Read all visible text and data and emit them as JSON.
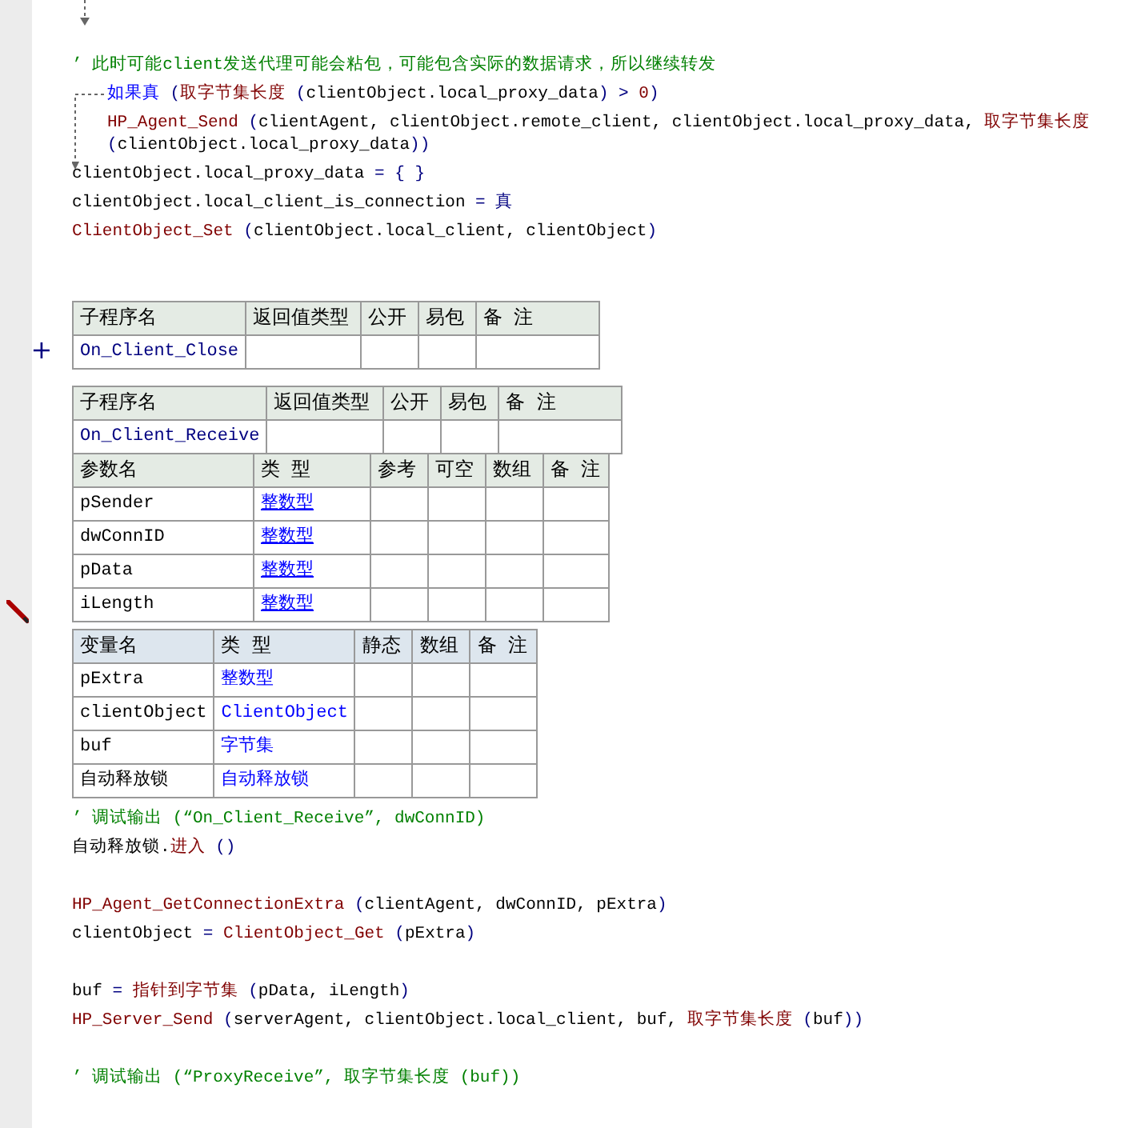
{
  "top_code": [
    {
      "kind": "line",
      "tokens": [
        {
          "kind": "comment",
          "text": "’ 此时可能client发送代理可能会粘包，可能包含实际的数据请求，所以继续转发"
        }
      ]
    },
    {
      "kind": "if",
      "tokens": [
        {
          "kind": "keyword",
          "text": "如果真"
        },
        {
          "kind": "punct",
          "text": " ("
        },
        {
          "kind": "func",
          "text": "取字节集长度"
        },
        {
          "kind": "punct",
          "text": " ("
        },
        {
          "kind": "text",
          "text": "clientObject.local_proxy_data"
        },
        {
          "kind": "punct",
          "text": ") > "
        },
        {
          "kind": "func",
          "text": "0"
        },
        {
          "kind": "punct",
          "text": ")"
        }
      ],
      "children": [
        {
          "kind": "line",
          "tokens": [
            {
              "kind": "func",
              "text": "HP_Agent_Send"
            },
            {
              "kind": "punct",
              "text": " ("
            },
            {
              "kind": "text",
              "text": "clientAgent, clientObject.remote_client, clientObject.local_proxy_data, "
            },
            {
              "kind": "func",
              "text": "取字节集长度"
            },
            {
              "kind": "punct",
              "text": " ("
            },
            {
              "kind": "text",
              "text": "clientObject.local_proxy_data"
            },
            {
              "kind": "punct",
              "text": "))"
            }
          ]
        }
      ]
    },
    {
      "kind": "line",
      "tokens": [
        {
          "kind": "text",
          "text": "clientObject.local_proxy_data"
        },
        {
          "kind": "punct",
          "text": " = { }"
        }
      ]
    },
    {
      "kind": "line",
      "tokens": [
        {
          "kind": "text",
          "text": "clientObject.local_client_is_connection"
        },
        {
          "kind": "punct",
          "text": " = 真"
        }
      ]
    },
    {
      "kind": "line",
      "tokens": [
        {
          "kind": "func",
          "text": "ClientObject_Set"
        },
        {
          "kind": "punct",
          "text": " ("
        },
        {
          "kind": "text",
          "text": "clientObject.local_client, clientObject"
        },
        {
          "kind": "punct",
          "text": ")"
        }
      ]
    }
  ],
  "subs": [
    {
      "toggle": "+",
      "header": [
        "子程序名",
        "返回值类型",
        "公开",
        "易包",
        "备 注"
      ],
      "name": "On_Client_Close"
    },
    {
      "header": [
        "子程序名",
        "返回值类型",
        "公开",
        "易包",
        "备 注"
      ],
      "name": "On_Client_Receive",
      "params": {
        "header": [
          "参数名",
          "类 型",
          "参考",
          "可空",
          "数组",
          "备 注"
        ],
        "rows": [
          {
            "name": "pSender",
            "type": "整数型"
          },
          {
            "name": "dwConnID",
            "type": "整数型"
          },
          {
            "name": "pData",
            "type": "整数型"
          },
          {
            "name": "iLength",
            "type": "整数型"
          }
        ]
      },
      "vars": {
        "header": [
          "变量名",
          "类 型",
          "静态",
          "数组",
          "备 注"
        ],
        "rows": [
          {
            "name": "pExtra",
            "type": "整数型"
          },
          {
            "name": "clientObject",
            "type": "ClientObject"
          },
          {
            "name": "buf",
            "type": "字节集"
          },
          {
            "name": "自动释放锁",
            "type": "自动释放锁"
          }
        ]
      }
    }
  ],
  "body_code": [
    {
      "kind": "line",
      "tokens": [
        {
          "kind": "comment",
          "text": "’ 调试输出 (“On_Client_Receive”, dwConnID)"
        }
      ]
    },
    {
      "kind": "line",
      "tokens": [
        {
          "kind": "text",
          "text": "自动释放锁."
        },
        {
          "kind": "func",
          "text": "进入"
        },
        {
          "kind": "punct",
          "text": " ()"
        }
      ]
    },
    {
      "kind": "blank"
    },
    {
      "kind": "line",
      "tokens": [
        {
          "kind": "func",
          "text": "HP_Agent_GetConnectionExtra"
        },
        {
          "kind": "punct",
          "text": " ("
        },
        {
          "kind": "text",
          "text": "clientAgent, dwConnID, pExtra"
        },
        {
          "kind": "punct",
          "text": ")"
        }
      ]
    },
    {
      "kind": "line",
      "tokens": [
        {
          "kind": "text",
          "text": "clientObject"
        },
        {
          "kind": "punct",
          "text": " = "
        },
        {
          "kind": "func",
          "text": "ClientObject_Get"
        },
        {
          "kind": "punct",
          "text": " ("
        },
        {
          "kind": "text",
          "text": "pExtra"
        },
        {
          "kind": "punct",
          "text": ")"
        }
      ]
    },
    {
      "kind": "blank"
    },
    {
      "kind": "line",
      "tokens": [
        {
          "kind": "text",
          "text": "buf"
        },
        {
          "kind": "punct",
          "text": " = "
        },
        {
          "kind": "func",
          "text": "指针到字节集"
        },
        {
          "kind": "punct",
          "text": " ("
        },
        {
          "kind": "text",
          "text": "pData, iLength"
        },
        {
          "kind": "punct",
          "text": ")"
        }
      ]
    },
    {
      "kind": "line",
      "tokens": [
        {
          "kind": "func",
          "text": "HP_Server_Send"
        },
        {
          "kind": "punct",
          "text": " ("
        },
        {
          "kind": "text",
          "text": "serverAgent, clientObject.local_client, buf, "
        },
        {
          "kind": "func",
          "text": "取字节集长度"
        },
        {
          "kind": "punct",
          "text": " ("
        },
        {
          "kind": "text",
          "text": "buf"
        },
        {
          "kind": "punct",
          "text": "))"
        }
      ]
    },
    {
      "kind": "blank"
    },
    {
      "kind": "line",
      "tokens": [
        {
          "kind": "comment",
          "text": "’ 调试输出 (“ProxyReceive”, 取字节集长度 (buf))"
        }
      ]
    }
  ]
}
